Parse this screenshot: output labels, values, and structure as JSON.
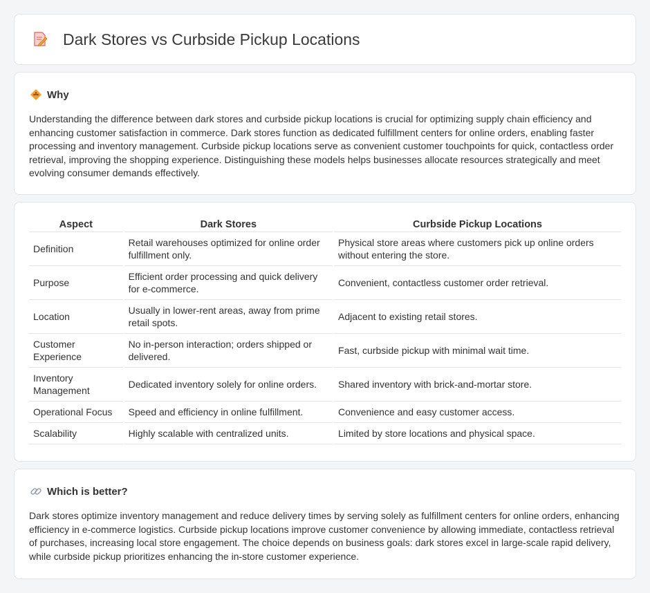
{
  "header": {
    "title": "Dark Stores vs Curbside Pickup Locations",
    "icon": "document-pencil-icon"
  },
  "why": {
    "heading": "Why",
    "icon": "diamond-warning-icon",
    "text": "Understanding the difference between dark stores and curbside pickup locations is crucial for optimizing supply chain efficiency and enhancing customer satisfaction in commerce. Dark stores function as dedicated fulfillment centers for online orders, enabling faster processing and inventory management. Curbside pickup locations serve as convenient customer touchpoints for quick, contactless order retrieval, improving the shopping experience. Distinguishing these models helps businesses allocate resources strategically and meet evolving consumer demands effectively."
  },
  "comparison": {
    "headers": [
      "Aspect",
      "Dark Stores",
      "Curbside Pickup Locations"
    ],
    "rows": [
      [
        "Definition",
        "Retail warehouses optimized for online order fulfillment only.",
        "Physical store areas where customers pick up online orders without entering the store."
      ],
      [
        "Purpose",
        "Efficient order processing and quick delivery for e-commerce.",
        "Convenient, contactless customer order retrieval."
      ],
      [
        "Location",
        "Usually in lower-rent areas, away from prime retail spots.",
        "Adjacent to existing retail stores."
      ],
      [
        "Customer Experience",
        "No in-person interaction; orders shipped or delivered.",
        "Fast, curbside pickup with minimal wait time."
      ],
      [
        "Inventory Management",
        "Dedicated inventory solely for online orders.",
        "Shared inventory with brick-and-mortar store."
      ],
      [
        "Operational Focus",
        "Speed and efficiency in online fulfillment.",
        "Convenience and easy customer access."
      ],
      [
        "Scalability",
        "Highly scalable with centralized units.",
        "Limited by store locations and physical space."
      ]
    ]
  },
  "better": {
    "heading": "Which is better?",
    "icon": "link-icon",
    "text": "Dark stores optimize inventory management and reduce delivery times by serving solely as fulfillment centers for online orders, enhancing efficiency in e-commerce logistics. Curbside pickup locations improve customer convenience by allowing immediate, contactless retrieval of purchases, increasing local store engagement. The choice depends on business goals: dark stores excel in large-scale rapid delivery, while curbside pickup prioritizes enhancing the in-store customer experience."
  },
  "colors": {
    "background": "#f4f5f7",
    "card": "#ffffff",
    "accent_orange": "#f0a030",
    "icon_pink": "#e8746a"
  }
}
